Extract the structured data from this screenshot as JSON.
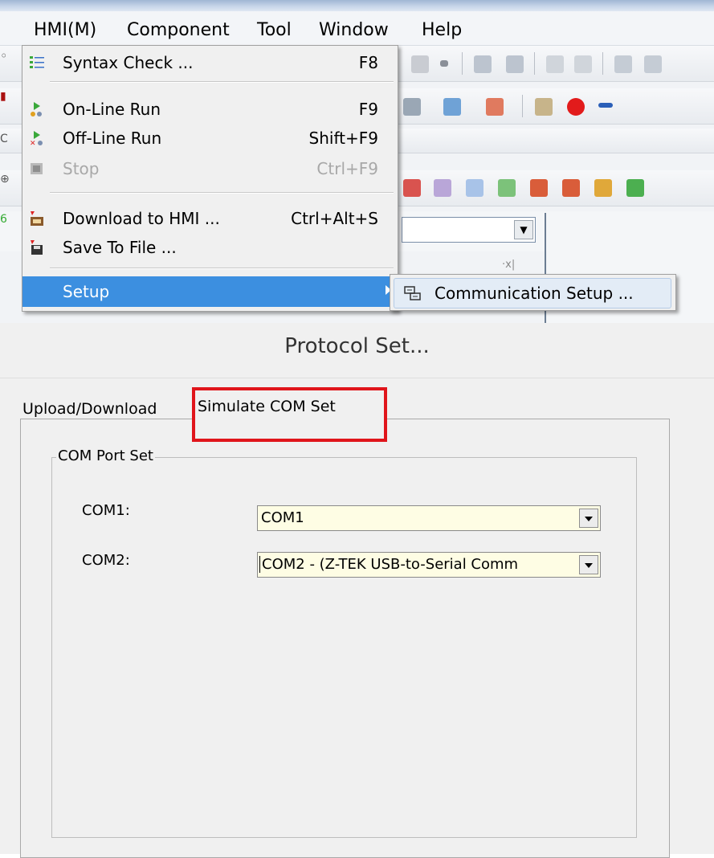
{
  "menubar": {
    "items": [
      "HMI(M)",
      "Component",
      "Tool",
      "Window",
      "Help"
    ]
  },
  "hmi_menu": {
    "items": [
      {
        "label": "Syntax Check ...",
        "shortcut": "F8",
        "icon": "syntax-check-icon"
      },
      {
        "label": "On-Line Run",
        "shortcut": "F9",
        "icon": "online-run-icon"
      },
      {
        "label": "Off-Line Run",
        "shortcut": "Shift+F9",
        "icon": "offline-run-icon"
      },
      {
        "label": "Stop",
        "shortcut": "Ctrl+F9",
        "icon": "stop-icon",
        "disabled": true
      },
      {
        "label": "Download to HMI ...",
        "shortcut": "Ctrl+Alt+S",
        "icon": "download-icon"
      },
      {
        "label": "Save To File ...",
        "shortcut": "",
        "icon": "save-icon"
      },
      {
        "label": "Setup",
        "shortcut": "",
        "highlighted": true
      }
    ]
  },
  "setup_submenu": {
    "item_label": "Communication Setup ...",
    "icon": "communication-icon"
  },
  "dialog": {
    "title": "Protocol Set...",
    "tabs": [
      "Upload/Download",
      "Simulate COM Set"
    ],
    "active_tab": "Simulate COM Set",
    "group_title": "COM Port Set",
    "com1": {
      "label": "COM1:",
      "value": "COM1"
    },
    "com2": {
      "label": "COM2:",
      "value": "COM2 - (Z-TEK USB-to-Serial Comm"
    }
  },
  "colors": {
    "menu_highlight": "#3c8fe0",
    "combo_background": "#fefde4",
    "annotation_border": "#e0151b"
  }
}
